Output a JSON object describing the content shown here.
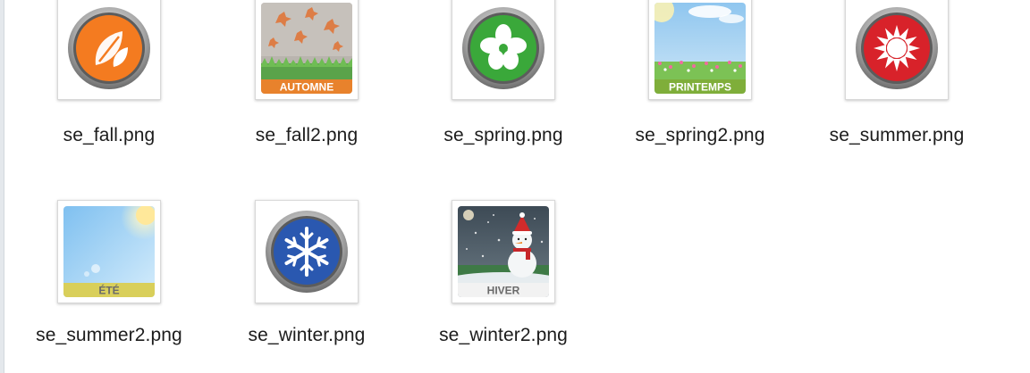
{
  "files": [
    {
      "name": "se_fall.png",
      "icon": "fall-leaf-icon",
      "accent": "#f47b20"
    },
    {
      "name": "se_fall2.png",
      "icon": "autumn-leaves-image",
      "banner": "AUTOMNE",
      "accent": "#e8822c"
    },
    {
      "name": "se_spring.png",
      "icon": "spring-flower-icon",
      "accent": "#3aa83a"
    },
    {
      "name": "se_spring2.png",
      "icon": "spring-meadow-image",
      "banner": "PRINTEMPS",
      "accent": "#7fae3a"
    },
    {
      "name": "se_summer.png",
      "icon": "summer-sun-icon",
      "accent": "#d8222a"
    },
    {
      "name": "se_summer2.png",
      "icon": "summer-sky-image",
      "banner": "ÉTÉ",
      "accent": "#d9cf5a"
    },
    {
      "name": "se_winter.png",
      "icon": "winter-snowflake-icon",
      "accent": "#2a58b0"
    },
    {
      "name": "se_winter2.png",
      "icon": "winter-snowman-image",
      "banner": "HIVER",
      "accent": "#dddddd"
    }
  ]
}
